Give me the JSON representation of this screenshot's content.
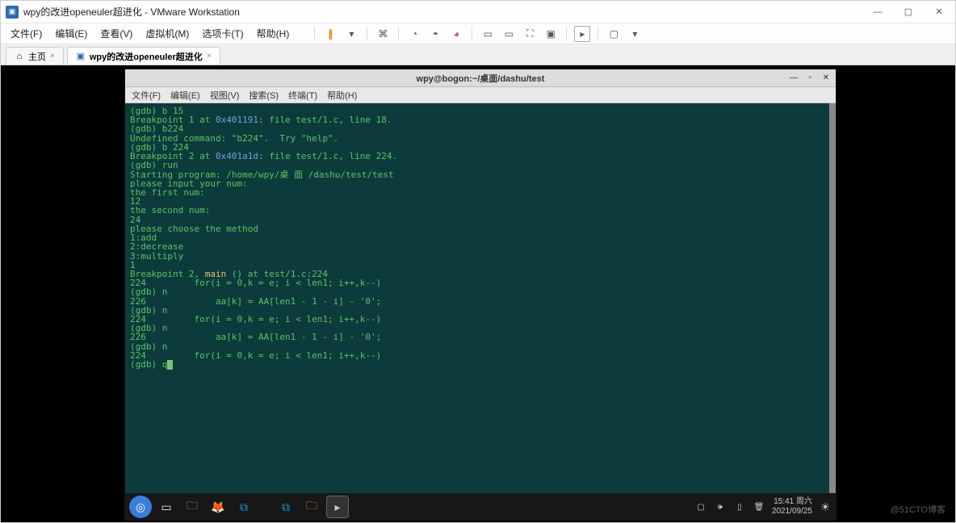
{
  "vmware": {
    "title": "wpy的改进openeuler超进化 - VMware Workstation",
    "menus": [
      "文件(F)",
      "编辑(E)",
      "查看(V)",
      "虚拟机(M)",
      "选项卡(T)",
      "帮助(H)"
    ],
    "tabs": [
      {
        "label": "主页",
        "active": false
      },
      {
        "label": "wpy的改进openeuler超进化",
        "active": true
      }
    ]
  },
  "gnome": {
    "title": "wpy@bogon:~/桌面/dashu/test",
    "menus": [
      "文件(F)",
      "编辑(E)",
      "视图(V)",
      "搜索(S)",
      "终端(T)",
      "帮助(H)"
    ]
  },
  "terminal_lines": [
    {
      "type": "plain",
      "text": "(gdb) b 15"
    },
    {
      "type": "bp",
      "text_pre": "Breakpoint 1 at ",
      "addr": "0x401191",
      "text_post": ": file test/1.c, line 18."
    },
    {
      "type": "plain",
      "text": "(gdb) b224"
    },
    {
      "type": "plain",
      "text": "Undefined command: \"b224\".  Try \"help\"."
    },
    {
      "type": "plain",
      "text": "(gdb) b 224"
    },
    {
      "type": "bp",
      "text_pre": "Breakpoint 2 at ",
      "addr": "0x401a1d",
      "text_post": ": file test/1.c, line 224."
    },
    {
      "type": "plain",
      "text": "(gdb) run"
    },
    {
      "type": "plain",
      "text": "Starting program: /home/wpy/桌 面 /dashu/test/test"
    },
    {
      "type": "plain",
      "text": "please input your num:"
    },
    {
      "type": "plain",
      "text": "the first num:"
    },
    {
      "type": "plain",
      "text": "12"
    },
    {
      "type": "plain",
      "text": ""
    },
    {
      "type": "plain",
      "text": "the second num:"
    },
    {
      "type": "plain",
      "text": "24"
    },
    {
      "type": "plain",
      "text": ""
    },
    {
      "type": "plain",
      "text": "please choose the method"
    },
    {
      "type": "plain",
      "text": ""
    },
    {
      "type": "plain",
      "text": "1:add"
    },
    {
      "type": "plain",
      "text": ""
    },
    {
      "type": "plain",
      "text": "2:decrease"
    },
    {
      "type": "plain",
      "text": ""
    },
    {
      "type": "plain",
      "text": "3:multiply"
    },
    {
      "type": "plain",
      "text": ""
    },
    {
      "type": "plain",
      "text": "1"
    },
    {
      "type": "plain",
      "text": ""
    },
    {
      "type": "main",
      "text_pre": "Breakpoint 2, ",
      "main": "main",
      "text_post": " () at test/1.c:224"
    },
    {
      "type": "plain",
      "text": "224         for(i = 0,k = e; i < len1; i++,k--)"
    },
    {
      "type": "plain",
      "text": "(gdb) n"
    },
    {
      "type": "plain",
      "text": "226             aa[k] = AA[len1 - 1 - i] - '0';"
    },
    {
      "type": "plain",
      "text": "(gdb) n"
    },
    {
      "type": "plain",
      "text": "224         for(i = 0,k = e; i < len1; i++,k--)"
    },
    {
      "type": "plain",
      "text": "(gdb) n"
    },
    {
      "type": "plain",
      "text": "226             aa[k] = AA[len1 - 1 - i] - '0';"
    },
    {
      "type": "plain",
      "text": "(gdb) n"
    },
    {
      "type": "plain",
      "text": "224         for(i = 0,k = e; i < len1; i++,k--)"
    },
    {
      "type": "cursor",
      "text": "(gdb) q"
    }
  ],
  "taskbar": {
    "time": "15:41 周六",
    "date": "2021/09/25"
  },
  "watermark": "@51CTO博客"
}
